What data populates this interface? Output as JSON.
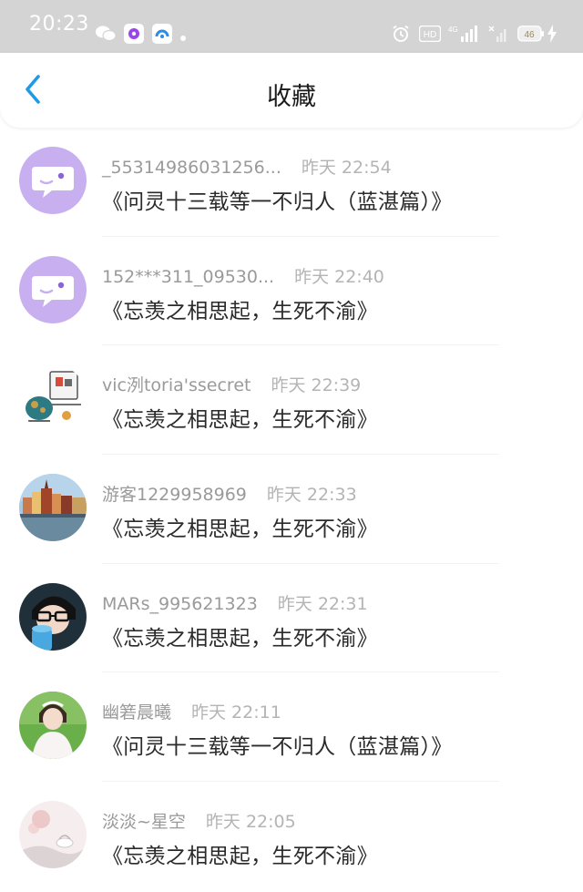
{
  "status_bar": {
    "time": "20:23",
    "network": "HD",
    "signal_label": "4G",
    "battery": "46"
  },
  "header": {
    "title": "收藏"
  },
  "items": [
    {
      "user": "_55314986031256...",
      "time": "昨天 22:54",
      "title": "《问灵十三载等一不归人（蓝湛篇）》"
    },
    {
      "user": "152***311_09530...",
      "time": "昨天 22:40",
      "title": "《忘羡之相思起，生死不渝》"
    },
    {
      "user": "vic洌toria'ssecret",
      "time": "昨天 22:39",
      "title": "《忘羡之相思起，生死不渝》"
    },
    {
      "user": "游客1229958969",
      "time": "昨天 22:33",
      "title": "《忘羡之相思起，生死不渝》"
    },
    {
      "user": "MARs_995621323",
      "time": "昨天 22:31",
      "title": "《忘羡之相思起，生死不渝》"
    },
    {
      "user": "幽箬晨曦",
      "time": "昨天 22:11",
      "title": "《问灵十三载等一不归人（蓝湛篇）》"
    },
    {
      "user": "淡淡~星空",
      "time": "昨天 22:05",
      "title": "《忘羡之相思起，生死不渝》"
    }
  ],
  "colors": {
    "status_bar_bg": "#d4d4d4",
    "accent_blue": "#1e9be6",
    "default_avatar": "#c8b0f0"
  }
}
